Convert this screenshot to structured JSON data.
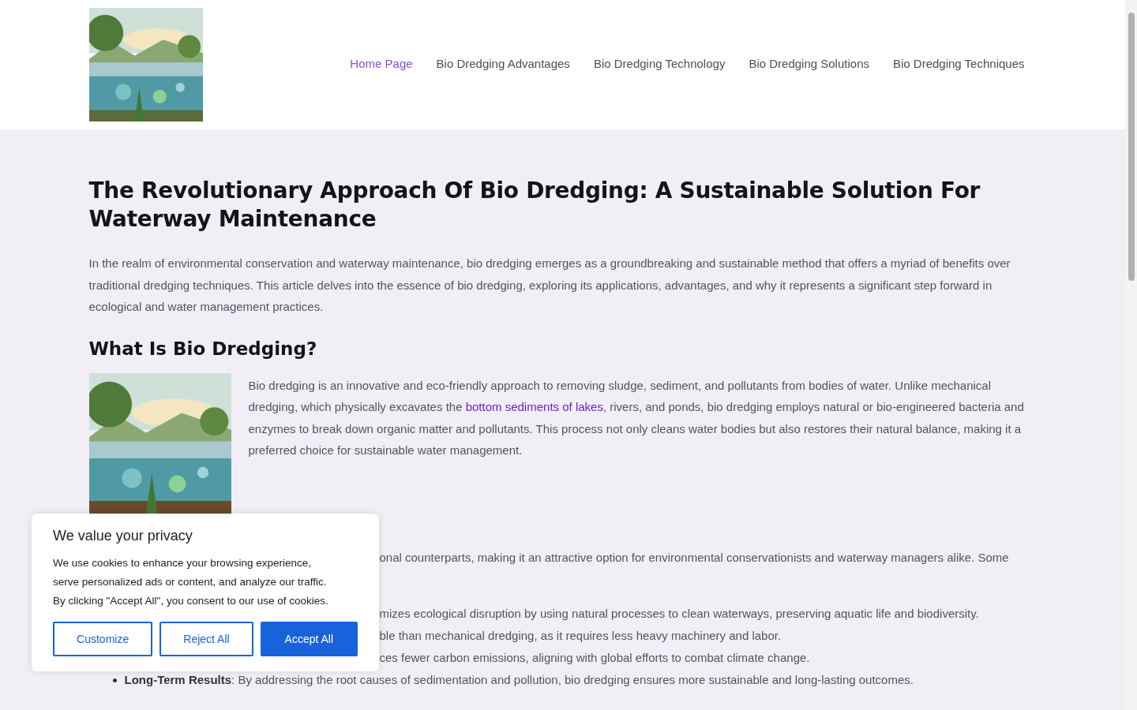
{
  "header": {
    "nav": [
      {
        "label": "Home Page",
        "selected": true
      },
      {
        "label": "Bio Dredging Advantages",
        "selected": false
      },
      {
        "label": "Bio Dredging Technology",
        "selected": false
      },
      {
        "label": "Bio Dredging Solutions",
        "selected": false
      },
      {
        "label": "Bio Dredging Techniques",
        "selected": false
      }
    ]
  },
  "article": {
    "title": "The Revolutionary Approach Of Bio Dredging: A Sustainable Solution For Waterway Maintenance",
    "intro": "In the realm of environmental conservation and waterway maintenance, bio dredging emerges as a groundbreaking and sustainable method that offers a myriad of benefits over traditional dredging techniques. This article delves into the essence of bio dredging, exploring its applications, advantages, and why it represents a significant step forward in ecological and water management practices.",
    "section": {
      "heading": "What Is Bio Dredging?",
      "paragraph": {
        "before": "Bio dredging is an innovative and eco-friendly approach to removing sludge, sediment, and pollutants from bodies of water. Unlike mechanical dredging, which physically excavates the ",
        "link": "bottom sediments of lakes",
        "after": ", rivers, and ponds, bio dredging employs natural or bio-engineered bacteria and enzymes to break down organic matter and pollutants. This process not only cleans water bodies but also restores their natural balance, making it a preferred choice for sustainable water management."
      }
    },
    "covered_paragraph": "onal counterparts, making it an attractive option for environmental conservationists and waterway managers alike. Some",
    "list": [
      {
        "text": "mizes ecological disruption by using natural processes to clean waterways, preserving aquatic life and biodiversity."
      },
      {
        "text": "ble than mechanical dredging, as it requires less heavy machinery and labor."
      },
      {
        "text": "ces fewer carbon emissions, aligning with global efforts to combat climate change."
      },
      {
        "label": "Long-Term Results",
        "text": ": By addressing the root causes of sedimentation and pollution, bio dredging ensures more sustainable and long-lasting outcomes."
      }
    ]
  },
  "cookie_banner": {
    "title": "We value your privacy",
    "text": "We use cookies to enhance your browsing experience, serve personalized ads or content, and analyze our traffic. By clicking \"Accept All\", you consent to our use of cookies.",
    "buttons": [
      {
        "label": "Customize",
        "kind": "outline"
      },
      {
        "label": "Reject All",
        "kind": "outline"
      },
      {
        "label": "Accept All",
        "kind": "primary"
      }
    ]
  }
}
